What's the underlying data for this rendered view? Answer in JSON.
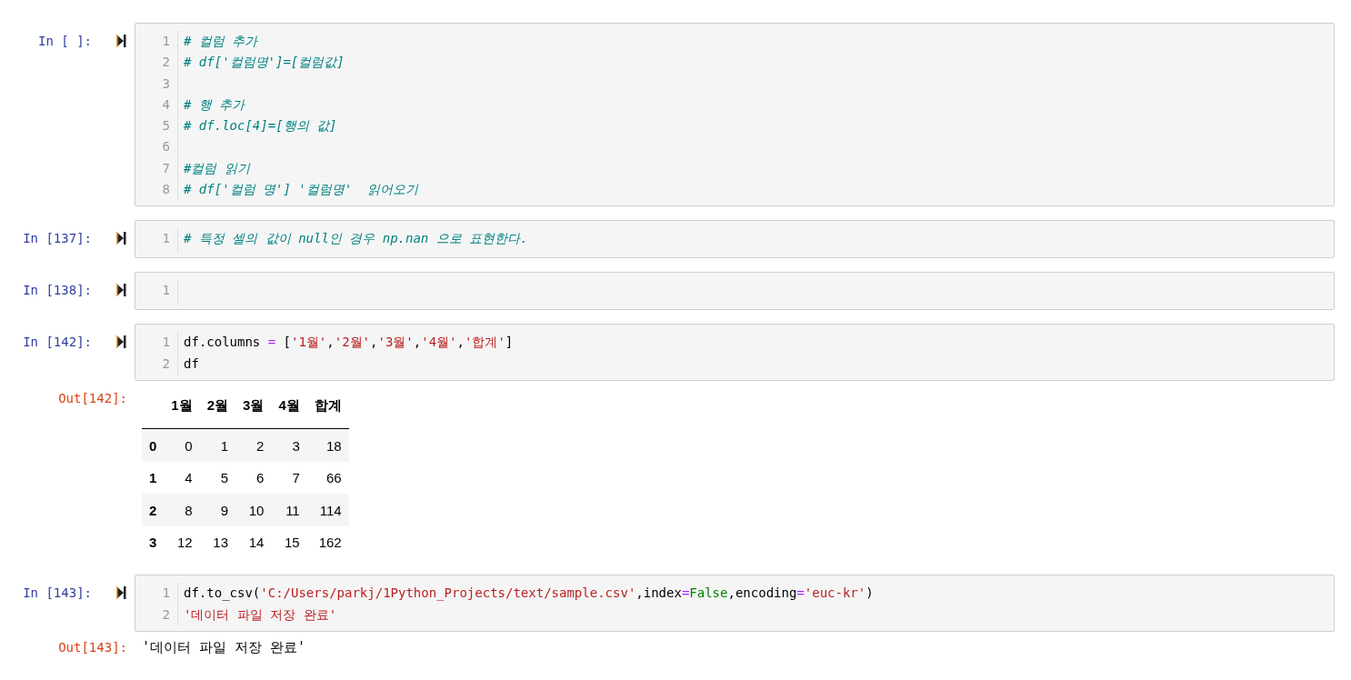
{
  "cells": [
    {
      "prompt": "In [ ]:",
      "lines": [
        {
          "number": "1",
          "tokens": [
            {
              "kind": "comment",
              "text": "# 컬럼 추가"
            }
          ]
        },
        {
          "number": "2",
          "tokens": [
            {
              "kind": "comment",
              "text": "# df['컬럼명']=[컬럼값]"
            }
          ]
        },
        {
          "number": "3"
        },
        {
          "number": "4",
          "tokens": [
            {
              "kind": "comment",
              "text": "# 행 추가"
            }
          ]
        },
        {
          "number": "5",
          "tokens": [
            {
              "kind": "comment",
              "text": "# df.loc[4]=[행의 값]"
            }
          ]
        },
        {
          "number": "6"
        },
        {
          "number": "7",
          "tokens": [
            {
              "kind": "comment",
              "text": "#컬럼 읽기"
            }
          ]
        },
        {
          "number": "8",
          "tokens": [
            {
              "kind": "comment",
              "text": "# df['컬럼 명'] '컬럼명'  읽어오기"
            }
          ]
        }
      ]
    },
    {
      "prompt": "In [137]:",
      "lines": [
        {
          "number": "1",
          "tokens": [
            {
              "kind": "comment",
              "text": "# 특정 셀의 값이 null인 경우 np.nan 으로 표현한다."
            }
          ]
        }
      ]
    },
    {
      "prompt": "In [138]:",
      "lines": [
        {
          "number": "1"
        }
      ]
    },
    {
      "prompt": "In [142]:",
      "lines": [
        {
          "number": "1",
          "tokens": [
            {
              "kind": "plain",
              "text": "df.columns "
            },
            {
              "kind": "operator",
              "text": "="
            },
            {
              "kind": "plain",
              "text": " ["
            },
            {
              "kind": "string",
              "text": "'1월'"
            },
            {
              "kind": "plain",
              "text": ","
            },
            {
              "kind": "string",
              "text": "'2월'"
            },
            {
              "kind": "plain",
              "text": ","
            },
            {
              "kind": "string",
              "text": "'3월'"
            },
            {
              "kind": "plain",
              "text": ","
            },
            {
              "kind": "string",
              "text": "'4월'"
            },
            {
              "kind": "plain",
              "text": ","
            },
            {
              "kind": "string",
              "text": "'합계'"
            },
            {
              "kind": "plain",
              "text": "]"
            }
          ]
        },
        {
          "number": "2",
          "tokens": [
            {
              "kind": "plain",
              "text": "df"
            }
          ]
        }
      ],
      "output": {
        "prompt": "Out[142]:",
        "kind": "table",
        "columns": [
          "1월",
          "2월",
          "3월",
          "4월",
          "합계"
        ],
        "rows": [
          {
            "index": "0",
            "values": [
              "0",
              "1",
              "2",
              "3",
              "18"
            ]
          },
          {
            "index": "1",
            "values": [
              "4",
              "5",
              "6",
              "7",
              "66"
            ]
          },
          {
            "index": "2",
            "values": [
              "8",
              "9",
              "10",
              "11",
              "114"
            ]
          },
          {
            "index": "3",
            "values": [
              "12",
              "13",
              "14",
              "15",
              "162"
            ]
          }
        ]
      }
    },
    {
      "prompt": "In [143]:",
      "lines": [
        {
          "number": "1",
          "tokens": [
            {
              "kind": "plain",
              "text": "df.to_csv("
            },
            {
              "kind": "string",
              "text": "'C:/Users/parkj/1Python_Projects/text/sample.csv'"
            },
            {
              "kind": "plain",
              "text": ",index"
            },
            {
              "kind": "operator",
              "text": "="
            },
            {
              "kind": "keyword",
              "text": "False"
            },
            {
              "kind": "plain",
              "text": ",encoding"
            },
            {
              "kind": "operator",
              "text": "="
            },
            {
              "kind": "string",
              "text": "'euc-kr'"
            },
            {
              "kind": "plain",
              "text": ")"
            }
          ]
        },
        {
          "number": "2",
          "tokens": [
            {
              "kind": "string",
              "text": "'데이터 파일 저장 완료'"
            }
          ]
        }
      ],
      "output": {
        "prompt": "Out[143]:",
        "kind": "text",
        "text": "'데이터 파일 저장 완료'"
      }
    }
  ]
}
